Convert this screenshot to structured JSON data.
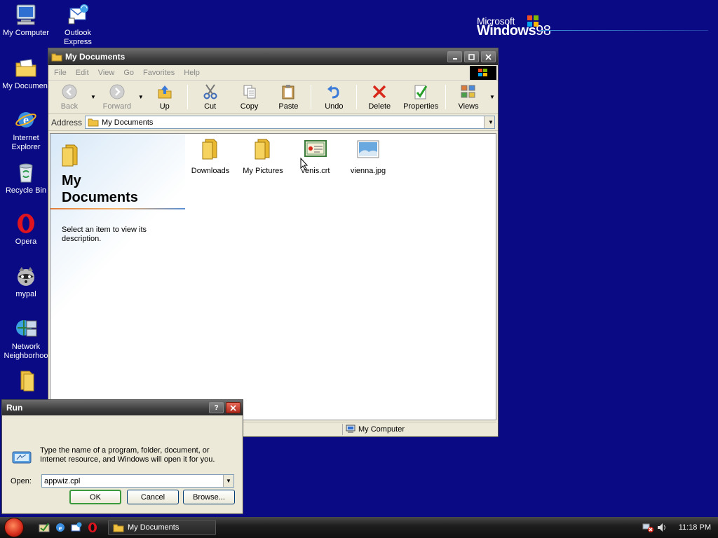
{
  "desktop": {
    "icons": [
      {
        "label": "My Computer"
      },
      {
        "label": "Outlook Express"
      },
      {
        "label": "My Document"
      },
      {
        "label": "Internet Explorer"
      },
      {
        "label": "Recycle Bin"
      },
      {
        "label": "Opera"
      },
      {
        "label": "mypal"
      },
      {
        "label": "Network Neighborhoo"
      }
    ],
    "logo": {
      "brand": "Microsoft",
      "product": "Windows",
      "version": "98"
    }
  },
  "explorer": {
    "title": "My Documents",
    "menu": [
      "File",
      "Edit",
      "View",
      "Go",
      "Favorites",
      "Help"
    ],
    "toolbar": {
      "back": "Back",
      "forward": "Forward",
      "up": "Up",
      "cut": "Cut",
      "copy": "Copy",
      "paste": "Paste",
      "undo": "Undo",
      "delete": "Delete",
      "properties": "Properties",
      "views": "Views"
    },
    "address": {
      "label": "Address",
      "value": "My Documents"
    },
    "left_pane": {
      "title_line1": "My",
      "title_line2": "Documents",
      "description": "Select an item to view its description."
    },
    "files": [
      {
        "name": "Downloads",
        "type": "folder"
      },
      {
        "name": "My Pictures",
        "type": "folder"
      },
      {
        "name": "venis.crt",
        "type": "certificate"
      },
      {
        "name": "vienna.jpg",
        "type": "image"
      }
    ],
    "status": {
      "zone": "My Computer"
    }
  },
  "run_dialog": {
    "title": "Run",
    "help_btn": "?",
    "message": "Type the name of a program, folder, document, or Internet resource, and Windows will open it for you.",
    "open_label": "Open:",
    "open_value": "appwiz.cpl",
    "ok": "OK",
    "cancel": "Cancel",
    "browse": "Browse..."
  },
  "taskbar": {
    "task_label": "My Documents",
    "clock": "11:18 PM"
  },
  "colors": {
    "desktop": "#0a0a84",
    "default_button_border": "#3b9a3b",
    "close_red": "#c0392b"
  }
}
